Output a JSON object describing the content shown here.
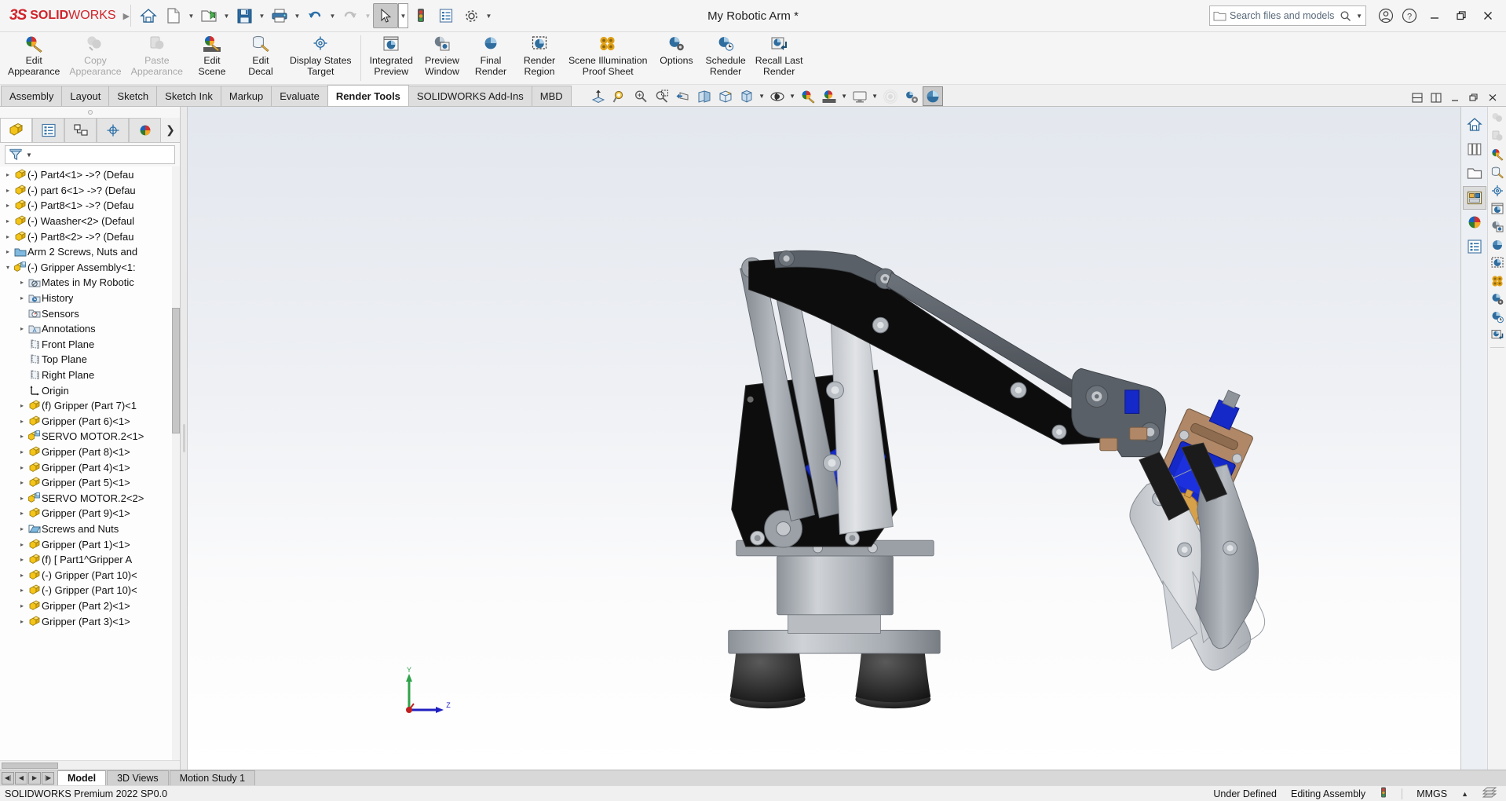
{
  "app": {
    "brand_ds": "3S",
    "brand_solid": "SOLID",
    "brand_works": "WORKS",
    "title": "My Robotic Arm *",
    "status_version": "SOLIDWORKS Premium 2022 SP0.0"
  },
  "quick_access": [
    {
      "name": "home-icon",
      "label": "Home"
    },
    {
      "name": "new-document-icon",
      "label": "New"
    },
    {
      "name": "open-folder-icon",
      "label": "Open"
    },
    {
      "name": "save-icon",
      "label": "Save"
    },
    {
      "name": "print-icon",
      "label": "Print"
    },
    {
      "name": "undo-icon",
      "label": "Undo"
    },
    {
      "name": "redo-icon",
      "label": "Redo"
    },
    {
      "name": "select-cursor-icon",
      "label": "Select"
    },
    {
      "name": "rebuild-traffic-light-icon",
      "label": "Rebuild"
    },
    {
      "name": "file-properties-icon",
      "label": "File Properties"
    },
    {
      "name": "options-gear-icon",
      "label": "Options"
    }
  ],
  "search": {
    "placeholder": "Search files and models",
    "icon": "search-icon",
    "folder_icon": "folder-icon",
    "dropdown_icon": "chevron-down-icon"
  },
  "window_controls": {
    "account": "user-account-icon",
    "help": "help-question-icon",
    "minimize": "minimize-icon",
    "restore": "restore-icon",
    "close": "close-icon"
  },
  "ribbon": {
    "groups": [
      {
        "items": [
          {
            "label": "Edit\nAppearance",
            "icon": "edit-appearance-icon",
            "disabled": false
          },
          {
            "label": "Copy\nAppearance",
            "icon": "copy-appearance-icon",
            "disabled": true
          },
          {
            "label": "Paste\nAppearance",
            "icon": "paste-appearance-icon",
            "disabled": true
          },
          {
            "label": "Edit\nScene",
            "icon": "edit-scene-icon",
            "disabled": false
          },
          {
            "label": "Edit\nDecal",
            "icon": "edit-decal-icon",
            "disabled": false
          },
          {
            "label": "Display States\nTarget",
            "icon": "display-states-target-icon",
            "disabled": false
          }
        ]
      },
      {
        "items": [
          {
            "label": "Integrated\nPreview",
            "icon": "integrated-preview-icon",
            "disabled": false
          },
          {
            "label": "Preview\nWindow",
            "icon": "preview-window-icon",
            "disabled": false
          },
          {
            "label": "Final\nRender",
            "icon": "final-render-icon",
            "disabled": false
          },
          {
            "label": "Render\nRegion",
            "icon": "render-region-icon",
            "disabled": false
          },
          {
            "label": "Scene Illumination\nProof Sheet",
            "icon": "scene-illumination-proof-sheet-icon",
            "disabled": false
          },
          {
            "label": "Options",
            "icon": "render-options-icon",
            "disabled": false
          },
          {
            "label": "Schedule\nRender",
            "icon": "schedule-render-icon",
            "disabled": false
          },
          {
            "label": "Recall Last\nRender",
            "icon": "recall-last-render-icon",
            "disabled": false
          }
        ]
      }
    ]
  },
  "command_tabs": [
    {
      "label": "Assembly",
      "active": false
    },
    {
      "label": "Layout",
      "active": false
    },
    {
      "label": "Sketch",
      "active": false
    },
    {
      "label": "Sketch Ink",
      "active": false
    },
    {
      "label": "Markup",
      "active": false
    },
    {
      "label": "Evaluate",
      "active": false
    },
    {
      "label": "Render Tools",
      "active": true
    },
    {
      "label": "SOLIDWORKS Add-Ins",
      "active": false
    },
    {
      "label": "MBD",
      "active": false
    }
  ],
  "view_toolbar": [
    {
      "name": "zoom-to-fit-icon",
      "caret": false,
      "selected": false
    },
    {
      "name": "zoom-to-area-icon",
      "caret": false,
      "selected": false
    },
    {
      "name": "zoom-in-out-icon",
      "caret": false,
      "selected": false
    },
    {
      "name": "zoom-to-selection-icon",
      "caret": false,
      "selected": false
    },
    {
      "name": "previous-view-icon",
      "caret": false,
      "selected": false
    },
    {
      "name": "section-view-icon",
      "caret": false,
      "selected": false
    },
    {
      "name": "view-orientation-icon",
      "caret": false,
      "selected": false
    },
    {
      "name": "display-style-icon",
      "caret": true,
      "selected": false
    },
    {
      "name": "hide-show-items-icon",
      "caret": true,
      "selected": false
    },
    {
      "name": "edit-appearance-view-icon",
      "caret": false,
      "selected": false
    },
    {
      "name": "apply-scene-icon",
      "caret": true,
      "selected": false
    },
    {
      "name": "view-settings-icon",
      "caret": true,
      "selected": false
    },
    {
      "name": "ambient-occlusion-icon",
      "caret": false,
      "selected": false
    },
    {
      "name": "perspective-icon",
      "caret": false,
      "selected": false
    },
    {
      "name": "realview-graphics-icon",
      "caret": false,
      "selected": true
    }
  ],
  "feature_manager": {
    "tabs": [
      {
        "name": "feature-manager-design-tree-tab",
        "active": true
      },
      {
        "name": "property-manager-tab",
        "active": false
      },
      {
        "name": "configuration-manager-tab",
        "active": false
      },
      {
        "name": "dimxpert-manager-tab",
        "active": false
      },
      {
        "name": "display-manager-tab",
        "active": false
      }
    ],
    "filter_icon": "filter-funnel-icon",
    "tree": [
      {
        "label": "(-) Part4<1> ->? (Defau",
        "icon": "part-icon",
        "indent": 0,
        "arrow": "right"
      },
      {
        "label": "(-) part 6<1> ->? (Defau",
        "icon": "part-icon",
        "indent": 0,
        "arrow": "right"
      },
      {
        "label": "(-) Part8<1> ->? (Defau",
        "icon": "part-icon",
        "indent": 0,
        "arrow": "right"
      },
      {
        "label": "(-) Waasher<2> (Defaul",
        "icon": "part-icon",
        "indent": 0,
        "arrow": "right"
      },
      {
        "label": "(-) Part8<2> ->? (Defau",
        "icon": "part-icon",
        "indent": 0,
        "arrow": "right"
      },
      {
        "label": "Arm 2 Screws, Nuts and",
        "icon": "folder-icon",
        "indent": 0,
        "arrow": "right"
      },
      {
        "label": "(-) Gripper Assembly<1:",
        "icon": "subassembly-icon",
        "indent": 0,
        "arrow": "down"
      },
      {
        "label": "Mates in My Robotic",
        "icon": "mates-folder-icon",
        "indent": 1,
        "arrow": "right"
      },
      {
        "label": "History",
        "icon": "history-folder-icon",
        "indent": 1,
        "arrow": "right"
      },
      {
        "label": "Sensors",
        "icon": "sensors-folder-icon",
        "indent": 1,
        "arrow": "none"
      },
      {
        "label": "Annotations",
        "icon": "annotations-folder-icon",
        "indent": 1,
        "arrow": "right"
      },
      {
        "label": "Front Plane",
        "icon": "plane-icon",
        "indent": 1,
        "arrow": "none"
      },
      {
        "label": "Top Plane",
        "icon": "plane-icon",
        "indent": 1,
        "arrow": "none"
      },
      {
        "label": "Right Plane",
        "icon": "plane-icon",
        "indent": 1,
        "arrow": "none"
      },
      {
        "label": "Origin",
        "icon": "origin-icon",
        "indent": 1,
        "arrow": "none"
      },
      {
        "label": "(f) Gripper (Part 7)<1",
        "icon": "part-icon",
        "indent": 1,
        "arrow": "right"
      },
      {
        "label": "Gripper (Part 6)<1>",
        "icon": "part-icon",
        "indent": 1,
        "arrow": "right"
      },
      {
        "label": "SERVO MOTOR.2<1>",
        "icon": "subassembly-icon",
        "indent": 1,
        "arrow": "right"
      },
      {
        "label": "Gripper (Part 8)<1>",
        "icon": "part-icon",
        "indent": 1,
        "arrow": "right"
      },
      {
        "label": "Gripper (Part 4)<1>",
        "icon": "part-icon",
        "indent": 1,
        "arrow": "right"
      },
      {
        "label": "Gripper (Part 5)<1>",
        "icon": "part-icon",
        "indent": 1,
        "arrow": "right"
      },
      {
        "label": "SERVO MOTOR.2<2>",
        "icon": "subassembly-icon",
        "indent": 1,
        "arrow": "right"
      },
      {
        "label": "Gripper (Part 9)<1>",
        "icon": "part-icon",
        "indent": 1,
        "arrow": "right"
      },
      {
        "label": "Screws and Nuts",
        "icon": "folder-open-icon",
        "indent": 1,
        "arrow": "right"
      },
      {
        "label": "Gripper (Part 1)<1>",
        "icon": "part-icon",
        "indent": 1,
        "arrow": "right"
      },
      {
        "label": "(f) [ Part1^Gripper A",
        "icon": "part-icon",
        "indent": 1,
        "arrow": "right"
      },
      {
        "label": "(-) Gripper (Part 10)<",
        "icon": "part-icon",
        "indent": 1,
        "arrow": "right"
      },
      {
        "label": "(-) Gripper (Part 10)<",
        "icon": "part-icon",
        "indent": 1,
        "arrow": "right"
      },
      {
        "label": "Gripper (Part 2)<1>",
        "icon": "part-icon",
        "indent": 1,
        "arrow": "right"
      },
      {
        "label": "Gripper (Part 3)<1>",
        "icon": "part-icon",
        "indent": 1,
        "arrow": "right"
      }
    ]
  },
  "graphics": {
    "triad": {
      "y_label": "Y",
      "z_label": "Z",
      "x_color": "#cc0000",
      "y_color": "#008000",
      "z_color": "#0000cc"
    },
    "window_buttons": [
      {
        "name": "tile-horizontally-icon"
      },
      {
        "name": "tile-vertically-icon"
      },
      {
        "name": "minimize-document-icon"
      },
      {
        "name": "restore-document-icon"
      },
      {
        "name": "close-document-icon"
      }
    ],
    "model_colors": {
      "black_link": "#0d0d0d",
      "dark_gray_link": "#4c5158",
      "light_gray_link": "#cfd2d6",
      "steel": "#9aa0a6",
      "blue_pcb": "#1528c8",
      "copper": "#b08868",
      "background_top": "#e3e7ee",
      "background_bottom": "#ffffff"
    }
  },
  "task_pane": [
    {
      "name": "solidworks-resources-icon",
      "active": false
    },
    {
      "name": "design-library-icon",
      "active": false
    },
    {
      "name": "file-explorer-icon",
      "active": false
    },
    {
      "name": "view-palette-icon",
      "active": true
    },
    {
      "name": "appearances-scenes-decals-icon",
      "active": false
    },
    {
      "name": "custom-properties-icon",
      "active": false
    }
  ],
  "edge_strip": [
    {
      "name": "copy-appearance-edge-icon"
    },
    {
      "name": "paste-appearance-edge-icon"
    },
    {
      "name": "edit-appearance-edge-icon"
    },
    {
      "name": "edit-decal-edge-icon"
    },
    {
      "name": "display-states-target-edge-icon"
    },
    {
      "name": "integrated-preview-edge-icon"
    },
    {
      "name": "preview-window-edge-icon"
    },
    {
      "name": "final-render-edge-icon"
    },
    {
      "name": "render-region-edge-icon"
    },
    {
      "name": "scene-illumination-edge-icon"
    },
    {
      "name": "render-options-edge-icon"
    },
    {
      "name": "schedule-render-edge-icon"
    },
    {
      "name": "recall-last-render-edge-icon"
    }
  ],
  "bottom": {
    "nav_buttons": [
      "first-tab-icon",
      "previous-tab-icon",
      "next-tab-icon",
      "last-tab-icon"
    ],
    "tabs": [
      {
        "label": "Model",
        "active": true
      },
      {
        "label": "3D Views",
        "active": false
      },
      {
        "label": "Motion Study 1",
        "active": false
      }
    ]
  },
  "status_bar": {
    "version": "SOLIDWORKS Premium 2022 SP0.0",
    "state": "Under Defined",
    "mode": "Editing Assembly",
    "rebuild_icon": "rebuild-traffic-light-icon",
    "units": "MMGS",
    "units_caret": "chevron-up-icon",
    "overlay_icon": "tile-overlay-icon"
  }
}
